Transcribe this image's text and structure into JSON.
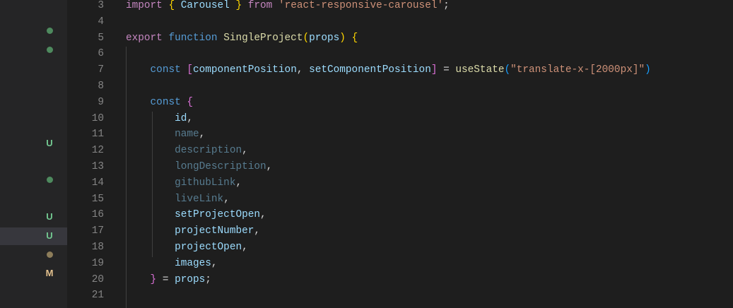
{
  "explorer": {
    "decorations": [
      {
        "type": "dot",
        "color": "#4e8a5e"
      },
      {
        "type": "dot",
        "color": "#4e8a5e"
      },
      {
        "type": "letter",
        "label": "U",
        "color": "#73c991"
      },
      {
        "type": "dot",
        "color": "#4e8a5e"
      },
      {
        "type": "letter",
        "label": "U",
        "color": "#73c991"
      },
      {
        "type": "letter",
        "label": "U",
        "color": "#73c991"
      },
      {
        "type": "dot",
        "color": "#8d7d5a"
      },
      {
        "type": "letter",
        "label": "M",
        "color": "#e2c08d"
      }
    ]
  },
  "editor": {
    "lines": [
      {
        "n": "3",
        "tokens": [
          [
            "kw",
            "import "
          ],
          [
            "b1",
            "{ "
          ],
          [
            "var",
            "Carousel"
          ],
          [
            "b1",
            " }"
          ],
          [
            "kw",
            " from "
          ],
          [
            "str",
            "'react-responsive-carousel'"
          ],
          [
            "pl",
            ";"
          ]
        ]
      },
      {
        "n": "4",
        "tokens": []
      },
      {
        "n": "5",
        "tokens": [
          [
            "kw",
            "export "
          ],
          [
            "st",
            "function "
          ],
          [
            "fn",
            "SingleProject"
          ],
          [
            "b1",
            "("
          ],
          [
            "var",
            "props"
          ],
          [
            "b1",
            ")"
          ],
          [
            "pl",
            " "
          ],
          [
            "b1",
            "{"
          ]
        ]
      },
      {
        "n": "6",
        "tokens": []
      },
      {
        "n": "7",
        "tokens": [
          [
            "pl",
            "    "
          ],
          [
            "st",
            "const "
          ],
          [
            "b2",
            "["
          ],
          [
            "var",
            "componentPosition"
          ],
          [
            "pl",
            ", "
          ],
          [
            "var",
            "setComponentPosition"
          ],
          [
            "b2",
            "]"
          ],
          [
            "pl",
            " = "
          ],
          [
            "fn",
            "useState"
          ],
          [
            "b3",
            "("
          ],
          [
            "str",
            "\"translate-x-[2000px]\""
          ],
          [
            "b3",
            ")"
          ]
        ]
      },
      {
        "n": "8",
        "tokens": []
      },
      {
        "n": "9",
        "tokens": [
          [
            "pl",
            "    "
          ],
          [
            "st",
            "const "
          ],
          [
            "b2",
            "{"
          ]
        ]
      },
      {
        "n": "10",
        "tokens": [
          [
            "pl",
            "        "
          ],
          [
            "var",
            "id"
          ],
          [
            "pl",
            ","
          ]
        ]
      },
      {
        "n": "11",
        "tokens": [
          [
            "pl",
            "        "
          ],
          [
            "dim",
            "name"
          ],
          [
            "pl",
            ","
          ]
        ]
      },
      {
        "n": "12",
        "tokens": [
          [
            "pl",
            "        "
          ],
          [
            "dim",
            "description"
          ],
          [
            "pl",
            ","
          ]
        ]
      },
      {
        "n": "13",
        "tokens": [
          [
            "pl",
            "        "
          ],
          [
            "dim",
            "longDescription"
          ],
          [
            "pl",
            ","
          ]
        ]
      },
      {
        "n": "14",
        "tokens": [
          [
            "pl",
            "        "
          ],
          [
            "dim",
            "githubLink"
          ],
          [
            "pl",
            ","
          ]
        ]
      },
      {
        "n": "15",
        "tokens": [
          [
            "pl",
            "        "
          ],
          [
            "dim",
            "liveLink"
          ],
          [
            "pl",
            ","
          ]
        ]
      },
      {
        "n": "16",
        "tokens": [
          [
            "pl",
            "        "
          ],
          [
            "var",
            "setProjectOpen"
          ],
          [
            "pl",
            ","
          ]
        ]
      },
      {
        "n": "17",
        "tokens": [
          [
            "pl",
            "        "
          ],
          [
            "var",
            "projectNumber"
          ],
          [
            "pl",
            ","
          ]
        ]
      },
      {
        "n": "18",
        "tokens": [
          [
            "pl",
            "        "
          ],
          [
            "var",
            "projectOpen"
          ],
          [
            "pl",
            ","
          ]
        ]
      },
      {
        "n": "19",
        "tokens": [
          [
            "pl",
            "        "
          ],
          [
            "var",
            "images"
          ],
          [
            "pl",
            ","
          ]
        ]
      },
      {
        "n": "20",
        "tokens": [
          [
            "pl",
            "    "
          ],
          [
            "b2",
            "}"
          ],
          [
            "pl",
            " = "
          ],
          [
            "var",
            "props"
          ],
          [
            "pl",
            ";"
          ]
        ]
      },
      {
        "n": "21",
        "tokens": []
      }
    ]
  }
}
